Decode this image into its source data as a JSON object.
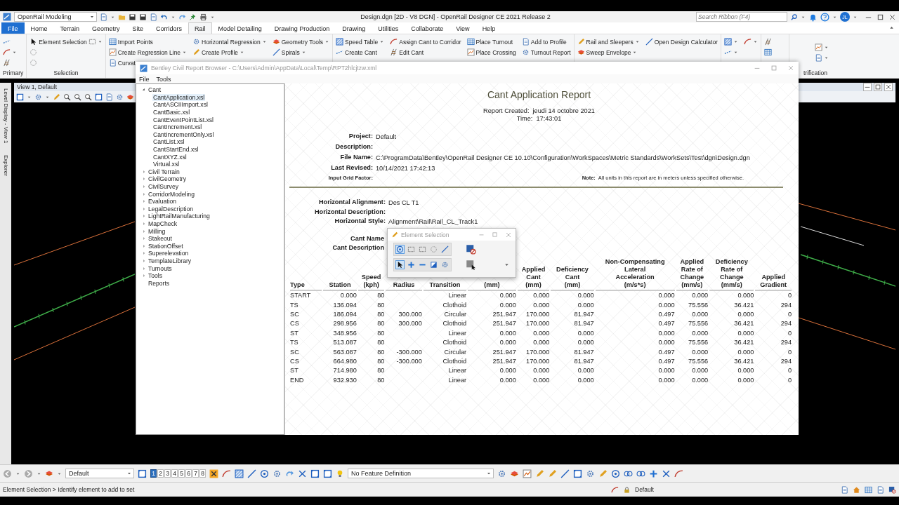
{
  "app": {
    "workspace": "OpenRail Modeling",
    "title": "Design.dgn [2D - V8 DGN] - OpenRail Designer CE 2021 Release 2",
    "search": {
      "placeholder": "Search Ribbon (F4)"
    },
    "user": "JL"
  },
  "ribbon_tabs": [
    {
      "label": "File",
      "kind": "file",
      "selected": false
    },
    {
      "label": "Home",
      "kind": "tab",
      "selected": false
    },
    {
      "label": "Terrain",
      "kind": "tab",
      "selected": false
    },
    {
      "label": "Geometry",
      "kind": "tab",
      "selected": false
    },
    {
      "label": "Site",
      "kind": "tab",
      "selected": false
    },
    {
      "label": "Corridors",
      "kind": "tab",
      "selected": false
    },
    {
      "label": "Rail",
      "kind": "tab",
      "selected": true
    },
    {
      "label": "Model Detailing",
      "kind": "tab",
      "selected": false
    },
    {
      "label": "Drawing Production",
      "kind": "tab",
      "selected": false
    },
    {
      "label": "Drawing",
      "kind": "tab",
      "selected": false
    },
    {
      "label": "Utilities",
      "kind": "tab",
      "selected": false
    },
    {
      "label": "Collaborate",
      "kind": "tab",
      "selected": false
    },
    {
      "label": "View",
      "kind": "tab",
      "selected": false
    },
    {
      "label": "Help",
      "kind": "tab",
      "selected": false
    }
  ],
  "ribbon_groups": [
    {
      "label": "Primary",
      "columns": [
        [
          {
            "dropdown": false
          },
          {
            "dropdown": true
          },
          {
            "dropdown": false
          }
        ]
      ]
    },
    {
      "label": "Selection",
      "columns": [
        [
          {
            "label": "Element Selection",
            "dropdown": true
          },
          {
            "dropdown": false
          },
          {
            "dropdown": false
          }
        ]
      ]
    },
    {
      "columns": [
        [
          {
            "label": "Import Points",
            "dropdown": false
          },
          {
            "label": "Create Regression Line",
            "dropdown": true
          },
          {
            "label": "Curvat",
            "dropdown": false
          }
        ],
        [
          {
            "label": "Horizontal Regression",
            "dropdown": true
          },
          {
            "label": "Create Profile",
            "dropdown": true
          }
        ],
        [
          {
            "label": "Geometry Tools",
            "dropdown": true
          },
          {
            "label": "Spirals",
            "dropdown": true
          }
        ]
      ]
    },
    {
      "columns": [
        [
          {
            "label": "Speed Table",
            "dropdown": true
          },
          {
            "label": "Create Cant",
            "dropdown": false
          }
        ],
        [
          {
            "label": "Assign Cant to Corridor",
            "dropdown": false
          },
          {
            "label": "Edit Cant",
            "dropdown": false
          }
        ],
        [
          {
            "label": "Place Turnout",
            "dropdown": false
          },
          {
            "label": "Place Crossing",
            "dropdown": false
          }
        ],
        [
          {
            "label": "Add to Profile",
            "dropdown": false
          },
          {
            "label": "Turnout Report",
            "dropdown": false
          }
        ]
      ]
    },
    {
      "columns": [
        [
          {
            "label": "Rail and Sleepers",
            "dropdown": true
          },
          {
            "label": "Sweep Envelope",
            "dropdown": true
          }
        ],
        [
          {
            "label": "Open Design Calculator",
            "dropdown": false
          }
        ]
      ]
    },
    {
      "columns": [
        [
          {
            "dropdown": true
          },
          {
            "dropdown": true
          }
        ],
        [
          {
            "dropdown": true
          }
        ]
      ]
    },
    {
      "columns": [
        [
          {
            "dropdown": false
          },
          {
            "dropdown": false
          }
        ]
      ]
    },
    {
      "label": "trification",
      "columns": [
        [
          {
            "dropdown": true
          },
          {
            "dropdown": true
          }
        ]
      ]
    }
  ],
  "cad_view": {
    "title": "View 1, Default",
    "side_tabs": [
      "Level Display - View 1",
      "Explorer"
    ]
  },
  "report_browser": {
    "title": "Bentley Civil Report Browser - C:\\Users\\Admin\\AppData\\Local\\Temp\\RPT2hlcjtzw.xml",
    "menu": [
      "File",
      "Tools"
    ],
    "tree": [
      {
        "label": "Cant",
        "expanded": true,
        "selected": false,
        "children": [
          {
            "label": "CantApplication.xsl",
            "selected": true
          },
          {
            "label": "CantASCIIImport.xsl",
            "selected": false
          },
          {
            "label": "CantBasic.xsl",
            "selected": false
          },
          {
            "label": "CantEventPointList.xsl",
            "selected": false
          },
          {
            "label": "CantIncrement.xsl",
            "selected": false
          },
          {
            "label": "CantIncrementOnly.xsl",
            "selected": false
          },
          {
            "label": "CantList.xsl",
            "selected": false
          },
          {
            "label": "CantStartEnd.xsl",
            "selected": false
          },
          {
            "label": "CantXYZ.xsl",
            "selected": false
          },
          {
            "label": "Virtual.xsl",
            "selected": false
          }
        ]
      },
      {
        "label": "Civil Terrain",
        "expanded": false,
        "selected": false
      },
      {
        "label": "CivilGeometry",
        "expanded": false,
        "selected": false
      },
      {
        "label": "CivilSurvey",
        "expanded": false,
        "selected": false
      },
      {
        "label": "CorridorModeling",
        "expanded": false,
        "selected": false
      },
      {
        "label": "Evaluation",
        "expanded": false,
        "selected": false
      },
      {
        "label": "LegalDescription",
        "expanded": false,
        "selected": false
      },
      {
        "label": "LightRailManufacturing",
        "expanded": false,
        "selected": false
      },
      {
        "label": "MapCheck",
        "expanded": false,
        "selected": false
      },
      {
        "label": "Milling",
        "expanded": false,
        "selected": false
      },
      {
        "label": "Stakeout",
        "expanded": false,
        "selected": false
      },
      {
        "label": "StationOffset",
        "expanded": false,
        "selected": false
      },
      {
        "label": "Superelevation",
        "expanded": false,
        "selected": false
      },
      {
        "label": "TemplateLibrary",
        "expanded": false,
        "selected": false
      },
      {
        "label": "Turnouts",
        "expanded": false,
        "selected": false
      },
      {
        "label": "Tools",
        "expanded": false,
        "selected": false
      },
      {
        "label": "Reports",
        "selected": false
      }
    ],
    "report": {
      "title": "Cant Application Report",
      "created": [
        {
          "label": "Report Created:",
          "value": "jeudi 14 octobre 2021"
        },
        {
          "label": "Time:",
          "value": "17:43:01"
        }
      ],
      "fields": [
        {
          "label": "Project:",
          "value": "Default"
        },
        {
          "label": "Description:"
        },
        {
          "label": "File Name:",
          "value": "C:\\ProgramData\\Bentley\\OpenRail Designer CE 10.10\\Configuration\\WorkSpaces\\Metric Standards\\WorkSets\\Test\\dgn\\Design.dgn"
        },
        {
          "label": "Last Revised:",
          "value": "10/14/2021 17:42:13"
        }
      ],
      "grid_factor_label": "Input Grid Factor:",
      "note": {
        "label": "Note:",
        "text": "All units in this report are in meters unless specified otherwise."
      },
      "alignment_fields": [
        {
          "label": "Horizontal Alignment:",
          "value": "Des CL T1"
        },
        {
          "label": "Horizontal Description:"
        },
        {
          "label": "Horizontal Style:",
          "value": "Alignment\\Rail\\Rail_CL_Track1"
        }
      ],
      "cant_fields": [
        {
          "label": "Cant Name"
        },
        {
          "label": "Cant Description"
        }
      ],
      "table": {
        "columns": [
          {
            "lines": [
              "Type"
            ]
          },
          {
            "lines": [
              "Station"
            ]
          },
          {
            "lines": [
              "Speed",
              "(kph)"
            ]
          },
          {
            "lines": [
              "Radius"
            ]
          },
          {
            "lines": [
              "Transition"
            ]
          },
          {
            "lines": [
              "(mm)"
            ]
          },
          {
            "lines": [
              "Applied",
              "Cant",
              "(mm)"
            ]
          },
          {
            "lines": [
              "Deficiency",
              "Cant",
              "(mm)"
            ]
          },
          {
            "lines": [
              "Non-Compensating",
              "Lateral",
              "Acceleration",
              "(m/s*s)"
            ]
          },
          {
            "lines": [
              "Applied",
              "Rate of",
              "Change",
              "(mm/s)"
            ]
          },
          {
            "lines": [
              "Deficiency",
              "Rate of",
              "Change",
              "(mm/s)"
            ]
          },
          {
            "lines": [
              "Applied",
              "Gradient"
            ]
          }
        ],
        "rows": [
          [
            "START",
            "0.000",
            "80",
            "",
            "Linear",
            "0.000",
            "0.000",
            "0.000",
            "0.000",
            "0.000",
            "0.000",
            "0"
          ],
          [
            "TS",
            "136.094",
            "80",
            "",
            "Clothoid",
            "0.000",
            "0.000",
            "0.000",
            "0.000",
            "75.556",
            "36.421",
            "294"
          ],
          [
            "SC",
            "186.094",
            "80",
            "300.000",
            "Circular",
            "251.947",
            "170.000",
            "81.947",
            "0.497",
            "0.000",
            "0.000",
            "0"
          ],
          [
            "CS",
            "298.956",
            "80",
            "300.000",
            "Clothoid",
            "251.947",
            "170.000",
            "81.947",
            "0.497",
            "75.556",
            "36.421",
            "294"
          ],
          [
            "ST",
            "348.956",
            "80",
            "",
            "Linear",
            "0.000",
            "0.000",
            "0.000",
            "0.000",
            "0.000",
            "0.000",
            "0"
          ],
          [
            "TS",
            "513.087",
            "80",
            "",
            "Clothoid",
            "0.000",
            "0.000",
            "0.000",
            "0.000",
            "75.556",
            "36.421",
            "294"
          ],
          [
            "SC",
            "563.087",
            "80",
            "-300.000",
            "Circular",
            "251.947",
            "170.000",
            "81.947",
            "0.497",
            "0.000",
            "0.000",
            "0"
          ],
          [
            "CS",
            "664.980",
            "80",
            "-300.000",
            "Clothoid",
            "251.947",
            "170.000",
            "81.947",
            "0.497",
            "75.556",
            "36.421",
            "294"
          ],
          [
            "ST",
            "714.980",
            "80",
            "",
            "Linear",
            "0.000",
            "0.000",
            "0.000",
            "0.000",
            "0.000",
            "0.000",
            "0"
          ],
          [
            "END",
            "932.930",
            "80",
            "",
            "Linear",
            "0.000",
            "0.000",
            "0.000",
            "0.000",
            "0.000",
            "0.000",
            "0"
          ]
        ]
      }
    }
  },
  "element_selection": {
    "title": "Element Selection",
    "methods": [
      {
        "selected": true
      },
      {
        "selected": false
      },
      {
        "selected": false
      },
      {
        "selected": false
      },
      {
        "selected": false
      }
    ],
    "modes": [
      {
        "selected": true
      },
      {
        "selected": false
      },
      {
        "selected": false
      },
      {
        "selected": false
      },
      {
        "selected": false
      }
    ]
  },
  "bottom_toolbar": {
    "level": "Default",
    "views": [
      {
        "label": "1",
        "selected": true
      },
      {
        "label": "2",
        "selected": false
      },
      {
        "label": "3",
        "selected": false
      },
      {
        "label": "4",
        "selected": false
      },
      {
        "label": "5",
        "selected": false
      },
      {
        "label": "6",
        "selected": false
      },
      {
        "label": "7",
        "selected": false
      },
      {
        "label": "8",
        "selected": false
      }
    ],
    "feature_definition": "No Feature Definition"
  },
  "status_bar": {
    "prompt": "Element Selection > Identify element to add to set",
    "model": "Default"
  }
}
